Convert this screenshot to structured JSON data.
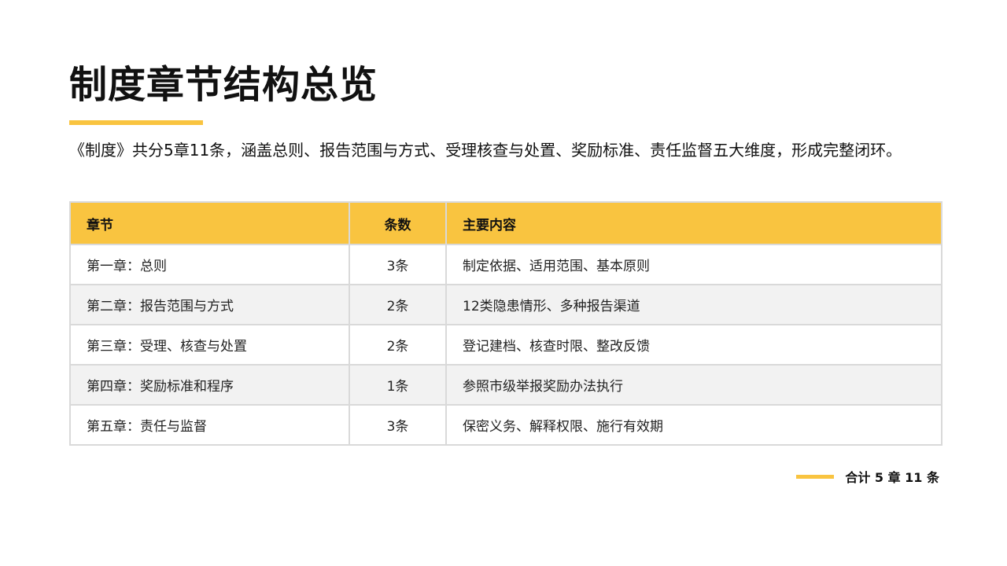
{
  "page": {
    "title": "制度章节结构总览",
    "intro": "《制度》共分5章11条，涵盖总则、报告范围与方式、受理核查与处置、奖励标准、责任监督五大维度，形成完整闭环。",
    "accent_color": "#f9c440"
  },
  "table": {
    "headers": {
      "chapter": "章节",
      "count": "条数",
      "content": "主要内容"
    },
    "rows": [
      {
        "chapter": "第一章：总则",
        "count": "3条",
        "content": "制定依据、适用范围、基本原则"
      },
      {
        "chapter": "第二章：报告范围与方式",
        "count": "2条",
        "content": "12类隐患情形、多种报告渠道"
      },
      {
        "chapter": "第三章：受理、核查与处置",
        "count": "2条",
        "content": "登记建档、核查时限、整改反馈"
      },
      {
        "chapter": "第四章：奖励标准和程序",
        "count": "1条",
        "content": "参照市级举报奖励办法执行"
      },
      {
        "chapter": "第五章：责任与监督",
        "count": "3条",
        "content": "保密义务、解释权限、施行有效期"
      }
    ]
  },
  "footer": {
    "total": "合计 5 章 11 条"
  }
}
